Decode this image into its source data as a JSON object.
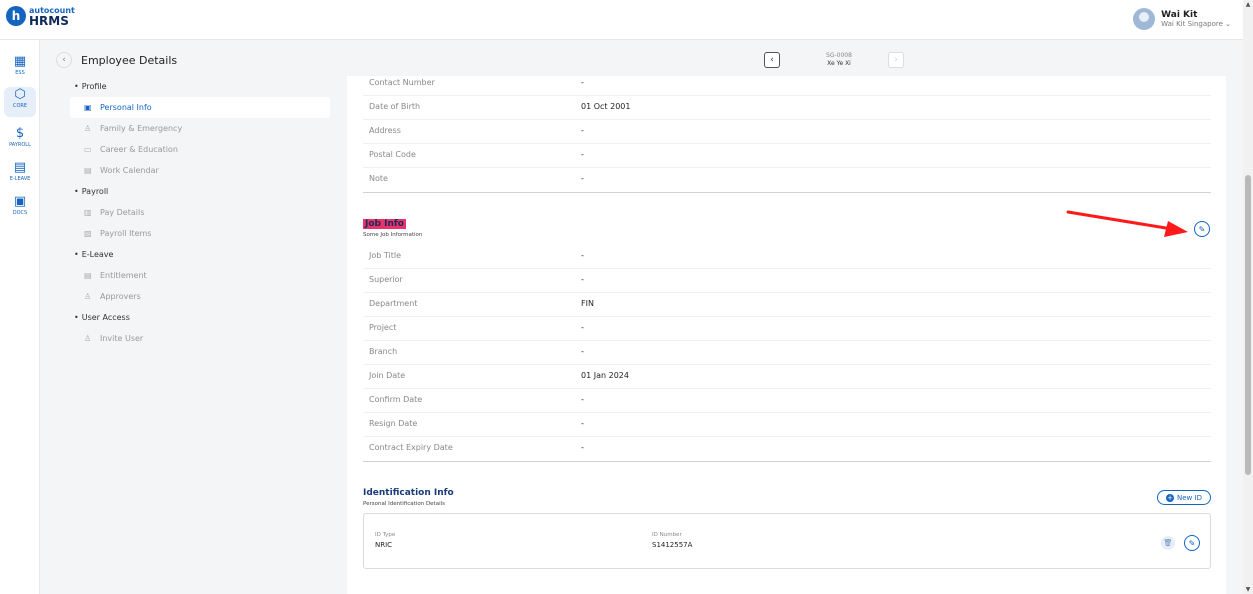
{
  "app": {
    "logo_letter": "h",
    "brand_top": "autocount",
    "brand_bottom": "HRMS"
  },
  "user": {
    "name": "Wai Kit",
    "company": "Wai Kit Singapore ⌄"
  },
  "rail": [
    {
      "label": "ESS",
      "icon": "ess-icon"
    },
    {
      "label": "CORE",
      "icon": "core-icon"
    },
    {
      "label": "PAYROLL",
      "icon": "payroll-icon"
    },
    {
      "label": "E-LEAVE",
      "icon": "calendar-icon"
    },
    {
      "label": "DOCS",
      "icon": "docs-icon"
    }
  ],
  "page": {
    "title": "Employee Details",
    "employee_id": "SG-0008",
    "employee_name": "Xe Ye Xi"
  },
  "sidenav": {
    "profile": "Profile",
    "personal_info": "Personal Info",
    "family": "Family & Emergency",
    "career": "Career & Education",
    "work_calendar": "Work Calendar",
    "payroll": "Payroll",
    "pay_details": "Pay Details",
    "payroll_items": "Payroll Items",
    "eleave": "E-Leave",
    "entitlement": "Entitlement",
    "approvers": "Approvers",
    "user_access": "User Access",
    "invite_user": "Invite User"
  },
  "personal": {
    "rows": [
      {
        "label": "Contact Number",
        "value": "-"
      },
      {
        "label": "Date of Birth",
        "value": "01 Oct 2001"
      },
      {
        "label": "Address",
        "value": "-"
      },
      {
        "label": "Postal Code",
        "value": "-"
      },
      {
        "label": "Note",
        "value": "-"
      }
    ]
  },
  "job": {
    "title": "Job Info",
    "subtitle": "Some Job Information",
    "rows": [
      {
        "label": "Job Title",
        "value": "-"
      },
      {
        "label": "Superior",
        "value": "-"
      },
      {
        "label": "Department",
        "value": "FIN"
      },
      {
        "label": "Project",
        "value": "-"
      },
      {
        "label": "Branch",
        "value": "-"
      },
      {
        "label": "Join Date",
        "value": "01 Jan 2024"
      },
      {
        "label": "Confirm Date",
        "value": "-"
      },
      {
        "label": "Resign Date",
        "value": "-"
      },
      {
        "label": "Contract Expiry Date",
        "value": "-"
      }
    ]
  },
  "identification": {
    "title": "Identification Info",
    "subtitle": "Personal Identification Details",
    "new_button": "New ID",
    "id_type_label": "ID Type",
    "id_type": "NRIC",
    "id_number_label": "ID Number",
    "id_number": "S1412557A"
  },
  "colors": {
    "accent": "#1565c0",
    "highlight": "#e8336b",
    "arrow": "#ff1a1a"
  }
}
